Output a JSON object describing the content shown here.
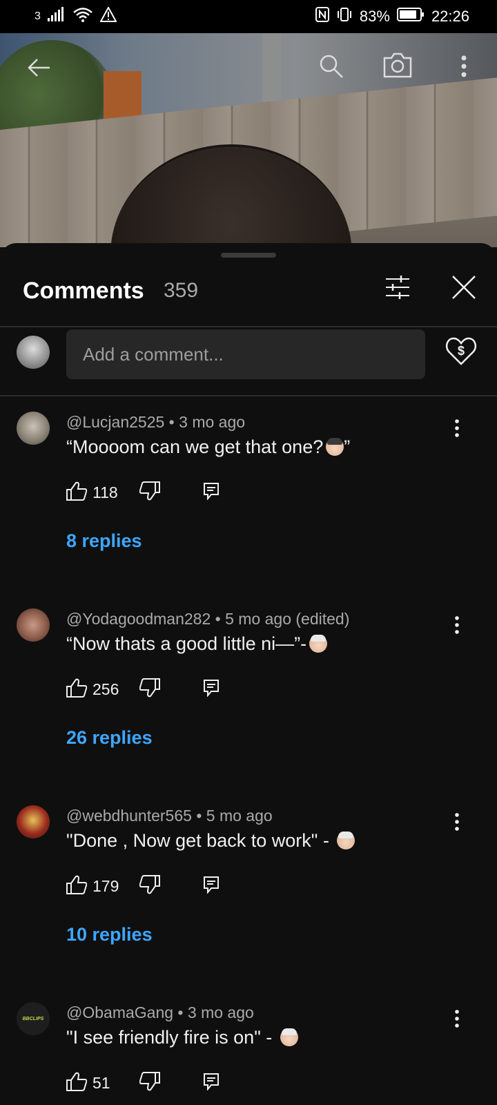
{
  "status_bar": {
    "carrier": "3",
    "battery": "83%",
    "time": "22:26"
  },
  "header": {
    "title": "Comments",
    "count": "359"
  },
  "add_comment": {
    "placeholder": "Add a comment..."
  },
  "comments": [
    {
      "handle": "@Lucjan2525",
      "age": "3 mo ago",
      "edited": "",
      "text": "“Moooom can we get that one?",
      "text_after_emoji": "”",
      "likes": "118",
      "replies": "8 replies"
    },
    {
      "handle": "@Yodagoodman282",
      "age": "5 mo ago",
      "edited": "(edited)",
      "text": "“Now thats a good little ni—”-",
      "text_after_emoji": "",
      "likes": "256",
      "replies": "26 replies"
    },
    {
      "handle": "@webdhunter565",
      "age": "5 mo ago",
      "edited": "",
      "text": "\"Done , Now get back to work\" -",
      "text_after_emoji": "",
      "likes": "179",
      "replies": "10 replies"
    },
    {
      "handle": "@ObamaGang",
      "age": "3 mo ago",
      "edited": "",
      "text": "\"I see friendly fire is on\" -",
      "text_after_emoji": "",
      "likes": "51",
      "replies": ""
    }
  ],
  "avatar_4_text": "BBCLIPS",
  "colors": {
    "background": "#0f0f0f",
    "link_blue": "#3ea6ff",
    "input_bg": "#272727"
  }
}
